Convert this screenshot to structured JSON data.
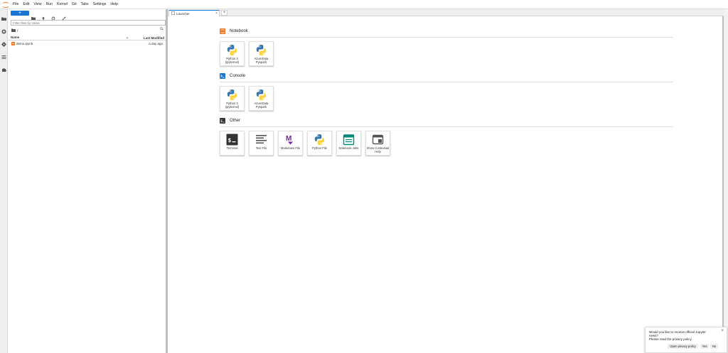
{
  "menubar": {
    "items": [
      "File",
      "Edit",
      "View",
      "Run",
      "Kernel",
      "Git",
      "Tabs",
      "Settings",
      "Help"
    ]
  },
  "sidebar": {
    "icons": [
      "folder-icon",
      "running-icon",
      "git-icon",
      "toc-icon",
      "extension-icon"
    ]
  },
  "filebrowser": {
    "new_label": "+",
    "filter_placeholder": "Filter files by name",
    "breadcrumb": "/",
    "columns": {
      "name": "Name",
      "modified": "Last Modified"
    },
    "files": [
      {
        "name": "demo.ipynb",
        "modified": "a day ago"
      }
    ]
  },
  "tabs": [
    {
      "label": "Launcher"
    }
  ],
  "launcher": {
    "sections": [
      {
        "title": "Notebook",
        "cards": [
          {
            "label": "Python 3 (ipykernel)",
            "icon": "python-icon"
          },
          {
            "label": "AzureData Pyspark",
            "icon": "python-icon"
          }
        ]
      },
      {
        "title": "Console",
        "cards": [
          {
            "label": "Python 3 (ipykernel)",
            "icon": "python-icon"
          },
          {
            "label": "AzureData Pyspark",
            "icon": "python-icon"
          }
        ]
      },
      {
        "title": "Other",
        "cards": [
          {
            "label": "Terminal",
            "icon": "terminal-icon"
          },
          {
            "label": "Text File",
            "icon": "text-file-icon"
          },
          {
            "label": "Markdown File",
            "icon": "markdown-icon"
          },
          {
            "label": "Python File",
            "icon": "python-icon"
          },
          {
            "label": "Notebook Jobs",
            "icon": "calendar-icon"
          },
          {
            "label": "Show Contextual Help",
            "icon": "help-window-icon"
          }
        ]
      }
    ]
  },
  "notification": {
    "line1": "Would you like to receive official Jupyter news?",
    "line2": "Please read the privacy policy.",
    "buttons": {
      "policy": "Open privacy policy",
      "yes": "Yes",
      "no": "No"
    }
  },
  "colors": {
    "accent": "#1976d2",
    "notebook": "#f37626",
    "console": "#1976d2",
    "other": "#333333",
    "markdown": "#7b1fa2",
    "jobs": "#00897b"
  }
}
